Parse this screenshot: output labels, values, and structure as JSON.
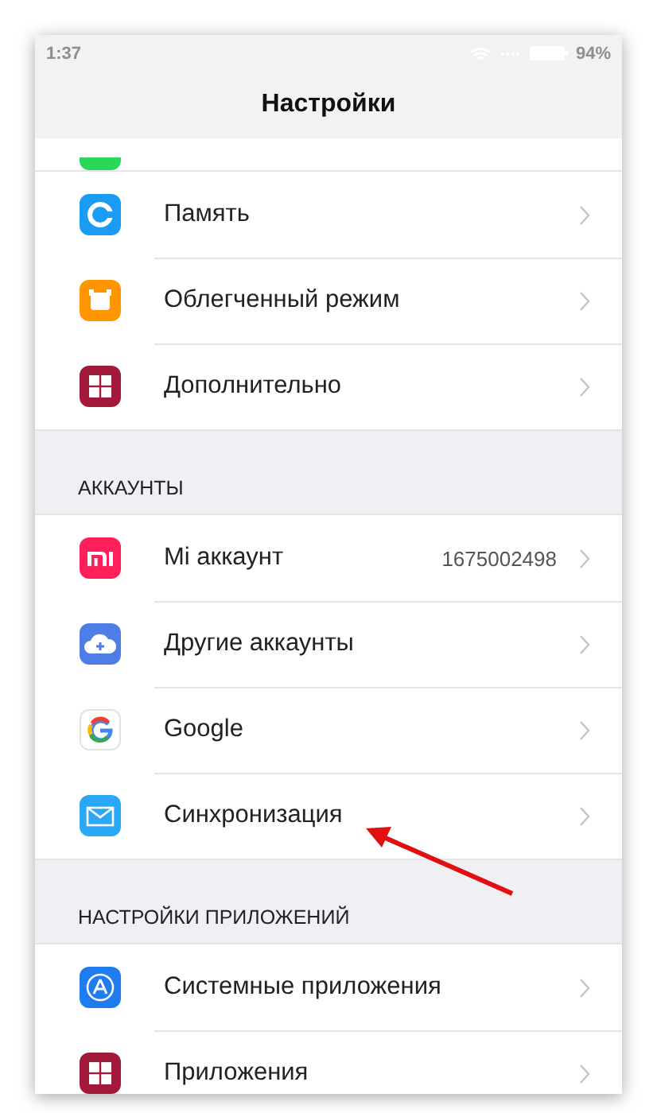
{
  "status_bar": {
    "time": "1:37",
    "battery": "94%"
  },
  "title": "Настройки",
  "sections": [
    {
      "items": [
        {
          "kind": "cut",
          "color": "#2bd65a"
        },
        {
          "kind": "row",
          "label": "Память",
          "color": "#1a9cf5"
        },
        {
          "kind": "row",
          "label": "Облегченный режим",
          "color": "#ff9500"
        },
        {
          "kind": "row",
          "label": "Дополнительно",
          "color": "#a3193a"
        }
      ]
    },
    {
      "header": "АККАУНТЫ",
      "items": [
        {
          "kind": "row",
          "label": "Mi аккаунт",
          "value": "1675002498",
          "color": "#ff1f5a"
        },
        {
          "kind": "row",
          "label": "Другие аккаунты",
          "color": "#4f7de8"
        },
        {
          "kind": "row",
          "label": "Google",
          "color": "#ffffff"
        },
        {
          "kind": "row",
          "label": "Синхронизация",
          "color": "#2aa8f5"
        }
      ]
    },
    {
      "header": "НАСТРОЙКИ ПРИЛОЖЕНИЙ",
      "items": [
        {
          "kind": "row",
          "label": "Системные приложения",
          "color": "#1f7cf0"
        },
        {
          "kind": "row",
          "label": "Приложения",
          "color": "#a3193a"
        }
      ]
    }
  ]
}
